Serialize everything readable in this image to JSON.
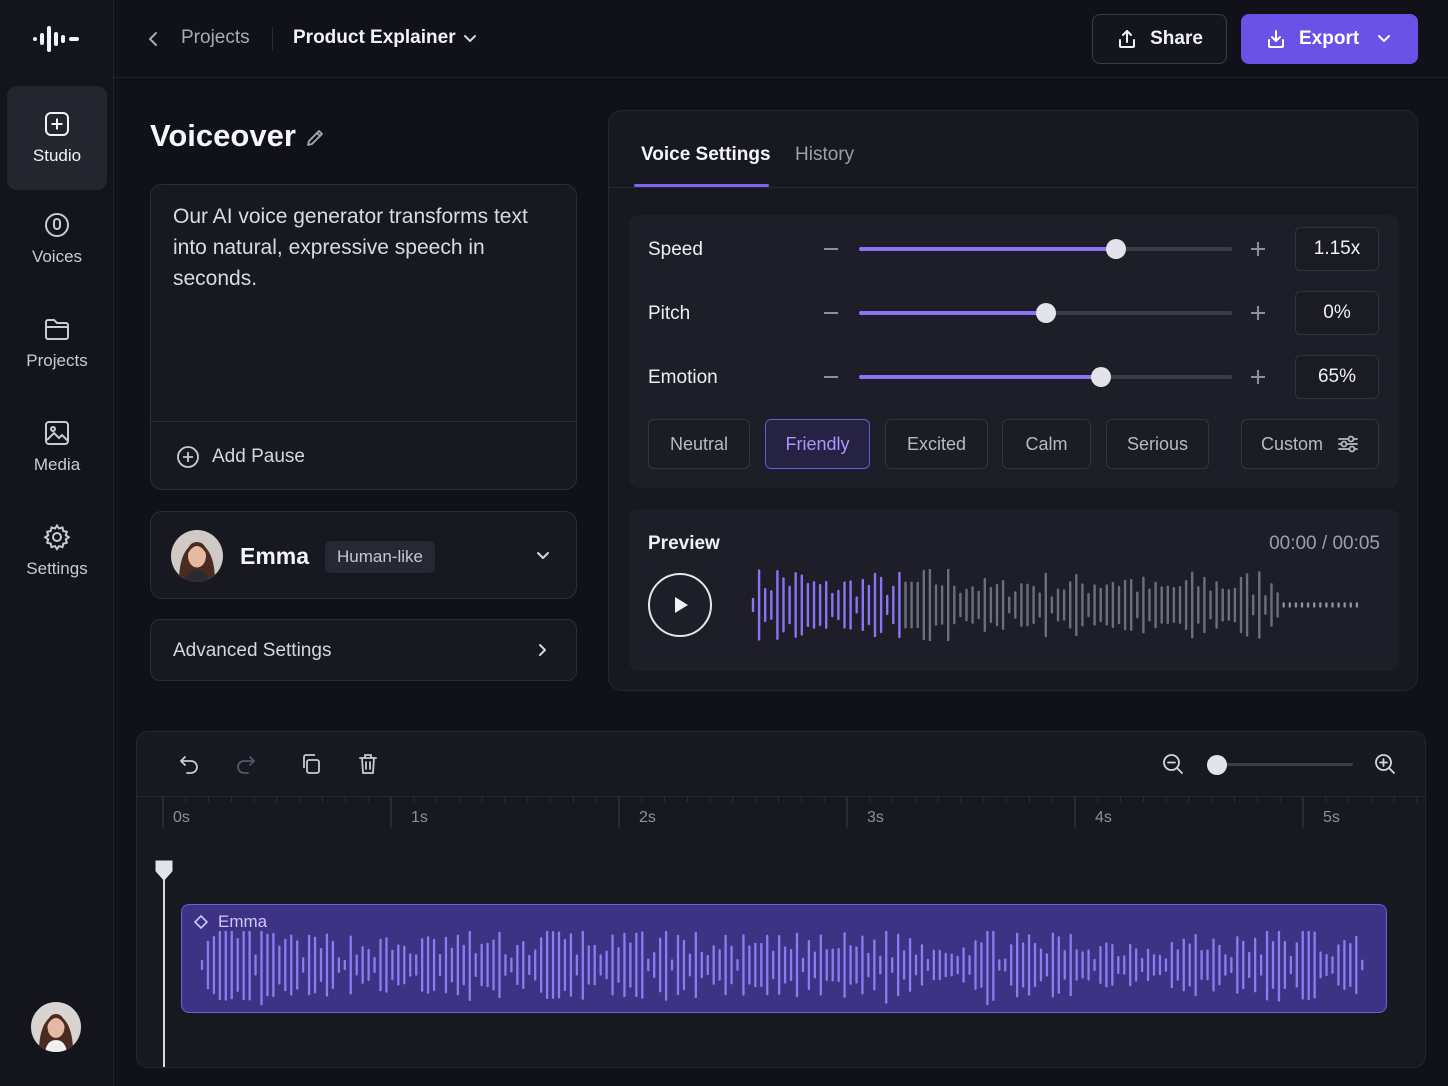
{
  "sidebar": {
    "items": [
      {
        "label": "Studio",
        "icon": "plus-square-icon",
        "active": true
      },
      {
        "label": "Voices",
        "icon": "voice-icon",
        "active": false
      },
      {
        "label": "Projects",
        "icon": "folder-icon",
        "active": false
      },
      {
        "label": "Media",
        "icon": "image-icon",
        "active": false
      },
      {
        "label": "Settings",
        "icon": "gear-icon",
        "active": false
      }
    ]
  },
  "header": {
    "breadcrumb_parent": "Projects",
    "breadcrumb_current": "Product Explainer",
    "share_label": "Share",
    "export_label": "Export"
  },
  "editor": {
    "title": "Voiceover",
    "script_text": "Our AI voice generator transforms text into natural, expressive speech in seconds.",
    "add_pause_label": "Add Pause",
    "voice": {
      "name": "Emma",
      "badge": "Human-like"
    },
    "advanced_settings_label": "Advanced Settings"
  },
  "voice_panel": {
    "tabs": [
      {
        "label": "Voice Settings",
        "active": true
      },
      {
        "label": "History",
        "active": false
      }
    ],
    "sliders": [
      {
        "label": "Speed",
        "value": "1.15x",
        "level": 0.69
      },
      {
        "label": "Pitch",
        "value": "0%",
        "level": 0.5
      },
      {
        "label": "Emotion",
        "value": "65%",
        "level": 0.65
      }
    ],
    "emotion_presets": [
      "Neutral",
      "Friendly",
      "Excited",
      "Calm",
      "Serious"
    ],
    "selected_preset": "Friendly",
    "custom_label": "Custom",
    "preview": {
      "label": "Preview",
      "time": "00:00 / 00:05"
    }
  },
  "timeline": {
    "ruler_labels": [
      "0s",
      "1s",
      "2s",
      "3s",
      "4s",
      "5s"
    ],
    "zoom_level": 0.0,
    "playhead_seconds": 0,
    "clip_label": "Emma"
  },
  "colors": {
    "accent": "#6a52e6",
    "accent_light": "#8a73f5",
    "background": "#111219",
    "panel": "#171820"
  }
}
